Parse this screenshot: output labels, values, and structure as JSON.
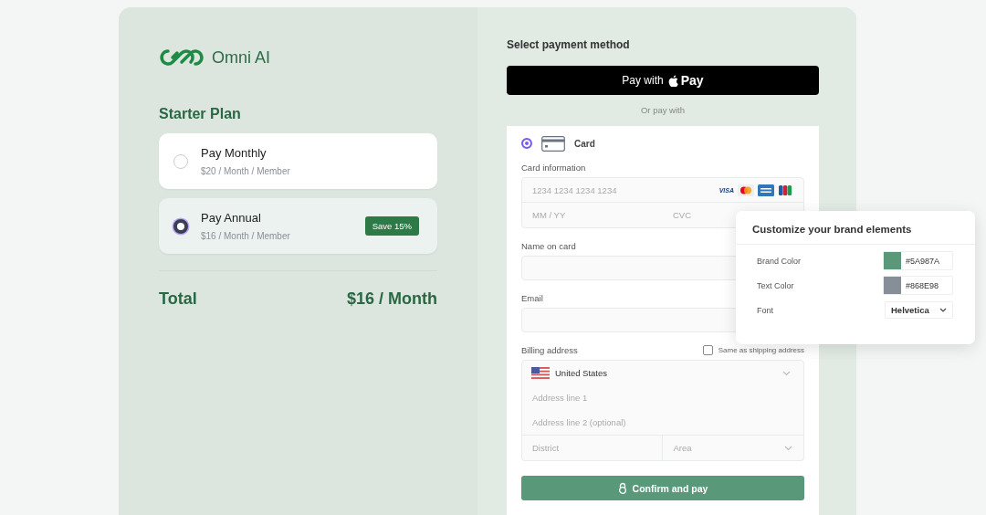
{
  "brand": {
    "name": "Omni AI"
  },
  "plan": {
    "title": "Starter Plan",
    "options": [
      {
        "name": "Pay Monthly",
        "price": "$20 / Month / Member",
        "selected": false
      },
      {
        "name": "Pay Annual",
        "price": "$16 / Month / Member",
        "selected": true,
        "badge": "Save 15%"
      }
    ],
    "total_label": "Total",
    "total_value": "$16 / Month"
  },
  "payment": {
    "title": "Select payment method",
    "apple_pay": {
      "label": "Pay with",
      "brand": "Pay"
    },
    "divider": "Or pay with",
    "method": {
      "label": "Card",
      "selected": true
    },
    "card_info": {
      "label": "Card information",
      "number_placeholder": "1234 1234 1234 1234",
      "card_brand": "VISA",
      "expiry_placeholder": "MM / YY",
      "cvc_placeholder": "CVC"
    },
    "name": {
      "label": "Name on card"
    },
    "email": {
      "label": "Email"
    },
    "billing": {
      "label": "Billing address",
      "same_as_shipping": {
        "label": "Same as shipping address",
        "checked": false
      },
      "country": "United States",
      "line1_placeholder": "Address line 1",
      "line2_placeholder": "Address line 2 (optional)",
      "district_placeholder": "District",
      "area_placeholder": "Area"
    },
    "confirm": "Confirm and pay"
  },
  "customize": {
    "title": "Customize your brand elements",
    "rows": [
      {
        "kind": "color",
        "label": "Brand Color",
        "value": "#5A987A",
        "color": "#5a987a"
      },
      {
        "kind": "color",
        "label": "Text Color",
        "value": "#868E98",
        "color": "#868e98"
      },
      {
        "kind": "select",
        "label": "Font",
        "value": "Helvetica"
      }
    ]
  }
}
